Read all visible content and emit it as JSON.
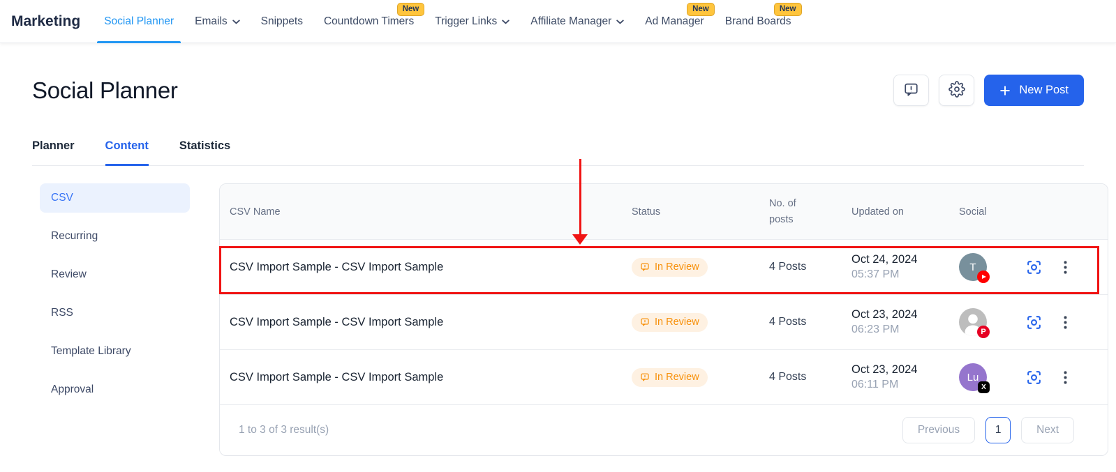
{
  "nav": {
    "brand": "Marketing",
    "items": [
      {
        "label": "Social Planner",
        "active": true
      },
      {
        "label": "Emails",
        "chevron": true
      },
      {
        "label": "Snippets"
      },
      {
        "label": "Countdown Timers",
        "badge": "New"
      },
      {
        "label": "Trigger Links",
        "chevron": true
      },
      {
        "label": "Affiliate Manager",
        "chevron": true
      },
      {
        "label": "Ad Manager",
        "badge": "New"
      },
      {
        "label": "Brand Boards",
        "badge": "New"
      }
    ]
  },
  "header": {
    "title": "Social Planner",
    "new_post_label": "New Post"
  },
  "tabs": [
    {
      "label": "Planner"
    },
    {
      "label": "Content",
      "active": true
    },
    {
      "label": "Statistics"
    }
  ],
  "sidebar": {
    "items": [
      {
        "label": "CSV",
        "active": true
      },
      {
        "label": "Recurring"
      },
      {
        "label": "Review"
      },
      {
        "label": "RSS"
      },
      {
        "label": "Template Library"
      },
      {
        "label": "Approval"
      }
    ]
  },
  "table": {
    "columns": [
      "CSV Name",
      "Status",
      "No. of posts",
      "Updated on",
      "Social"
    ],
    "rows": [
      {
        "name": "CSV Import Sample - CSV Import Sample",
        "status": "In Review",
        "posts": "4 Posts",
        "date": "Oct 24, 2024",
        "time": "05:37 PM",
        "avatar_text": "T",
        "avatar_style": "background:#78909C",
        "network": "youtube",
        "highlighted": true
      },
      {
        "name": "CSV Import Sample - CSV Import Sample",
        "status": "In Review",
        "posts": "4 Posts",
        "date": "Oct 23, 2024",
        "time": "06:23 PM",
        "avatar_text": "",
        "avatar_style": "background:#BDBDBD",
        "network": "pinterest",
        "highlighted": false
      },
      {
        "name": "CSV Import Sample - CSV Import Sample",
        "status": "In Review",
        "posts": "4 Posts",
        "date": "Oct 23, 2024",
        "time": "06:11 PM",
        "avatar_text": "Lu",
        "avatar_style": "background:#9575CD",
        "network": "x",
        "highlighted": false
      }
    ],
    "footer": {
      "results": "1 to 3 of 3 result(s)",
      "previous": "Previous",
      "page": "1",
      "next": "Next"
    }
  },
  "icons": {
    "feedback": "speech-bubble-alert",
    "settings": "gear",
    "new_post": "plus",
    "nav_chevron": "chevron-down",
    "status": "alert-bubble",
    "scan": "focus-scan",
    "row_menu": "kebab-vertical",
    "youtube": "play-circle",
    "pinterest": "pinterest-p",
    "x": "x-logo",
    "gray_avatar": "person-silhouette"
  },
  "colors": {
    "accent_blue": "#2563EB",
    "nav_active_blue": "#2196F3",
    "badge_yellow": "#FFC53D",
    "status_orange": "#F79009",
    "status_bg": "#FEF1E2",
    "annotation_red": "#F01414",
    "sidebar_active_bg": "#EBF2FE",
    "border_gray": "#EAECF0"
  }
}
